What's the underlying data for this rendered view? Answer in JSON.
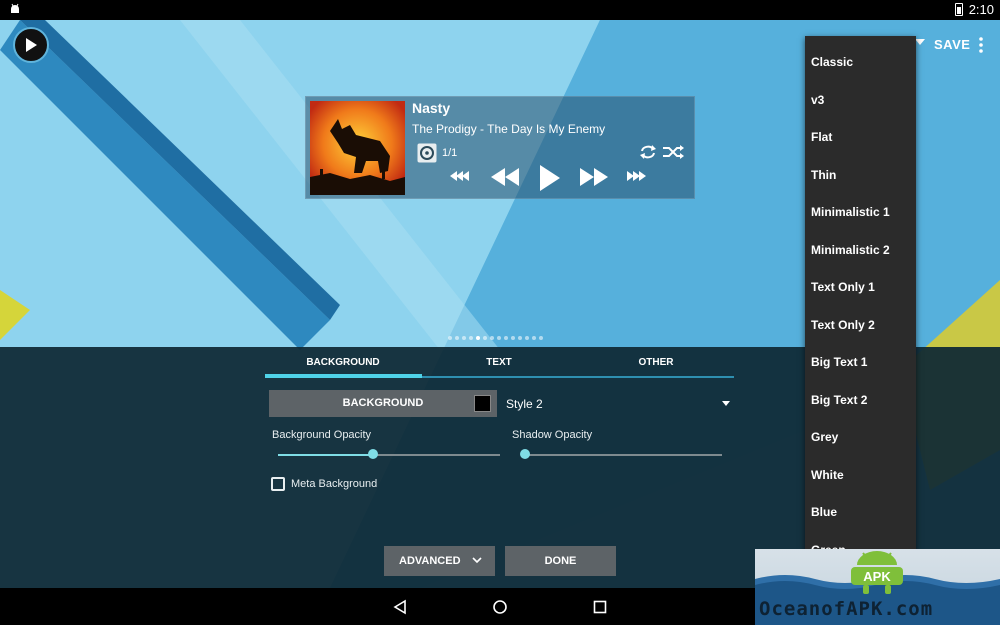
{
  "status_bar": {
    "time": "2:10"
  },
  "toolbar": {
    "save_label": "SAVE"
  },
  "widget": {
    "title": "Nasty",
    "artist_album": "The Prodigy - The Day Is My Enemy",
    "queue_position": "1/1"
  },
  "tabs": [
    {
      "label": "BACKGROUND",
      "active": true
    },
    {
      "label": "TEXT",
      "active": false
    },
    {
      "label": "OTHER",
      "active": false
    }
  ],
  "background": {
    "button_label": "BACKGROUND",
    "swatch_color": "#000000",
    "style_value": "Style 2"
  },
  "sliders": {
    "background_opacity": {
      "label": "Background Opacity",
      "value": 0.43
    },
    "shadow_opacity": {
      "label": "Shadow Opacity",
      "value": 0.0
    }
  },
  "meta_background": {
    "label": "Meta Background",
    "checked": false
  },
  "actions": {
    "advanced_label": "ADVANCED",
    "done_label": "DONE"
  },
  "style_menu": {
    "items": [
      "Classic",
      "v3",
      "Flat",
      "Thin",
      "Minimalistic 1",
      "Minimalistic 2",
      "Text Only 1",
      "Text Only 2",
      "Big Text 1",
      "Big Text 2",
      "Grey",
      "White",
      "Blue",
      "Green"
    ]
  },
  "page_indicator": {
    "count": 14,
    "active_index": 4
  },
  "watermark": {
    "text": "OceanofAPK.com",
    "logo_text": "APK"
  },
  "colors": {
    "accent": "#4fd3e8",
    "panel": "#0e2834",
    "button": "#5d6367"
  }
}
